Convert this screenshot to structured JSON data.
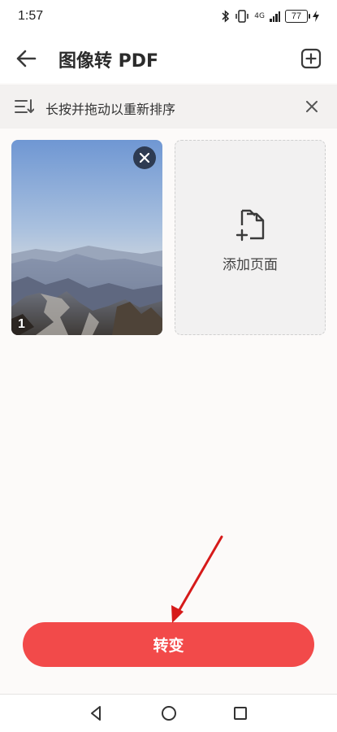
{
  "status_bar": {
    "time": "1:57",
    "battery": "77",
    "network": "4G"
  },
  "header": {
    "title": "图像转 PDF",
    "back_icon": "arrow-left-icon",
    "add_icon": "plus-square-icon"
  },
  "hint_bar": {
    "text": "长按并拖动以重新排序",
    "sort_icon": "sort-lines-icon",
    "close_icon": "close-icon"
  },
  "pages": [
    {
      "number": "1",
      "image": "mountain-landscape-photo"
    }
  ],
  "add_page": {
    "label": "添加页面",
    "icon": "add-document-icon"
  },
  "convert_button": {
    "label": "转变",
    "color": "#f24a4a"
  },
  "annotation": {
    "arrow_color": "#d61a1a"
  },
  "colors": {
    "background": "#fcfaf9",
    "hint_bar": "#f3f1f0",
    "remove_button": "#2e3b52"
  }
}
